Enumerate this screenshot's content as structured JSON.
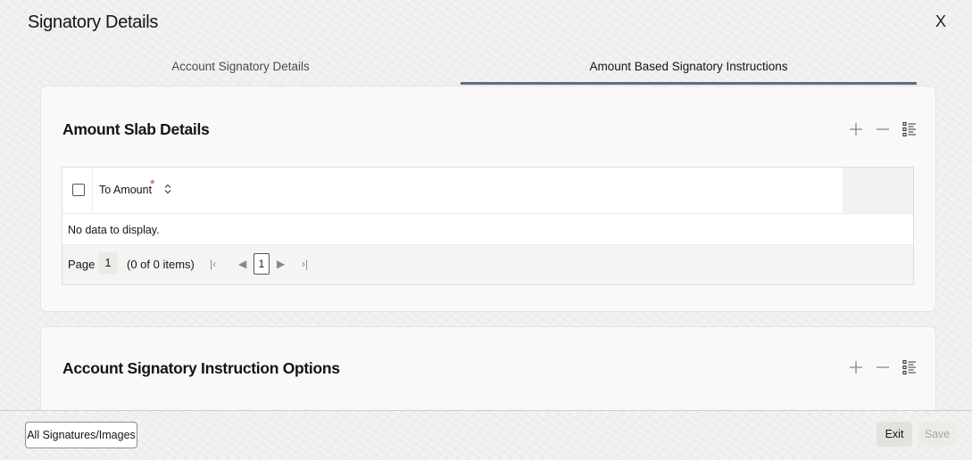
{
  "window": {
    "title": "Signatory Details",
    "close_label": "X"
  },
  "tabs": [
    {
      "label": "Account Signatory Details",
      "active": false
    },
    {
      "label": "Amount Based Signatory Instructions",
      "active": true
    }
  ],
  "amount_slab": {
    "title": "Amount Slab Details",
    "icons": [
      "add-icon",
      "remove-icon",
      "single-record-view-icon"
    ],
    "columns": [
      {
        "label": "To Amount",
        "required_mark": "*"
      }
    ],
    "empty_text": "No data to display.",
    "pager": {
      "label": "Page",
      "page_value": "1",
      "count_text": "(0 of 0 items)",
      "current_page": "1"
    }
  },
  "signatory_options": {
    "title": "Account Signatory Instruction Options",
    "icons": [
      "add-icon",
      "remove-icon",
      "single-record-view-icon"
    ]
  },
  "footer": {
    "signatures_label": "All Signatures/Images",
    "exit_label": "Exit",
    "save_label": "Save"
  },
  "colors": {
    "accent": "#5e6c85",
    "required": "#c74634",
    "background": "#f3f2f0"
  }
}
